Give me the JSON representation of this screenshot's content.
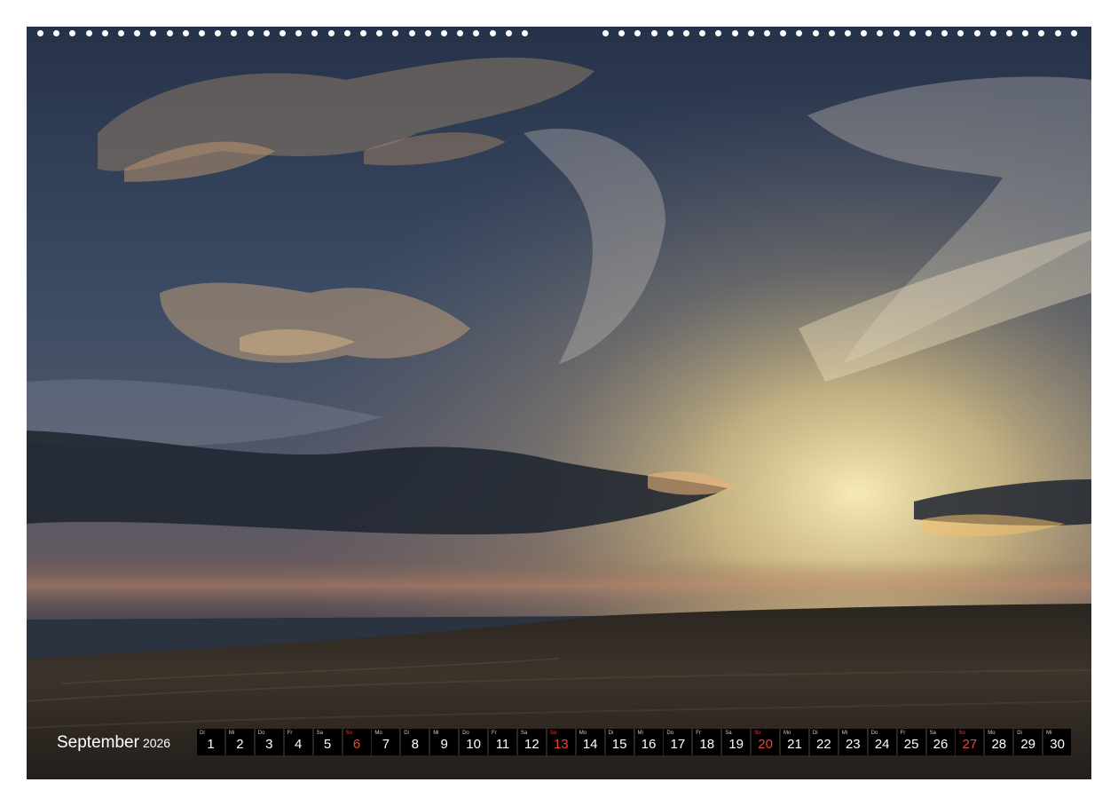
{
  "calendar": {
    "month": "September",
    "year": "2026",
    "days": [
      {
        "wd": "Di",
        "n": "1",
        "sunday": false
      },
      {
        "wd": "Mi",
        "n": "2",
        "sunday": false
      },
      {
        "wd": "Do",
        "n": "3",
        "sunday": false
      },
      {
        "wd": "Fr",
        "n": "4",
        "sunday": false
      },
      {
        "wd": "Sa",
        "n": "5",
        "sunday": false
      },
      {
        "wd": "So",
        "n": "6",
        "sunday": true
      },
      {
        "wd": "Mo",
        "n": "7",
        "sunday": false
      },
      {
        "wd": "Di",
        "n": "8",
        "sunday": false
      },
      {
        "wd": "Mi",
        "n": "9",
        "sunday": false
      },
      {
        "wd": "Do",
        "n": "10",
        "sunday": false
      },
      {
        "wd": "Fr",
        "n": "11",
        "sunday": false
      },
      {
        "wd": "Sa",
        "n": "12",
        "sunday": false
      },
      {
        "wd": "So",
        "n": "13",
        "sunday": true
      },
      {
        "wd": "Mo",
        "n": "14",
        "sunday": false
      },
      {
        "wd": "Di",
        "n": "15",
        "sunday": false
      },
      {
        "wd": "Mi",
        "n": "16",
        "sunday": false
      },
      {
        "wd": "Do",
        "n": "17",
        "sunday": false
      },
      {
        "wd": "Fr",
        "n": "18",
        "sunday": false
      },
      {
        "wd": "Sa",
        "n": "19",
        "sunday": false
      },
      {
        "wd": "So",
        "n": "20",
        "sunday": true
      },
      {
        "wd": "Mo",
        "n": "21",
        "sunday": false
      },
      {
        "wd": "Di",
        "n": "22",
        "sunday": false
      },
      {
        "wd": "Mi",
        "n": "23",
        "sunday": false
      },
      {
        "wd": "Do",
        "n": "24",
        "sunday": false
      },
      {
        "wd": "Fr",
        "n": "25",
        "sunday": false
      },
      {
        "wd": "Sa",
        "n": "26",
        "sunday": false
      },
      {
        "wd": "So",
        "n": "27",
        "sunday": true
      },
      {
        "wd": "Mo",
        "n": "28",
        "sunday": false
      },
      {
        "wd": "Di",
        "n": "29",
        "sunday": false
      },
      {
        "wd": "Mi",
        "n": "30",
        "sunday": false
      }
    ]
  },
  "colors": {
    "sunday": "#e8473a",
    "weekday": "#ffffff",
    "cell": "#000000"
  },
  "photo": {
    "icon": "sunset-landscape-photo"
  }
}
